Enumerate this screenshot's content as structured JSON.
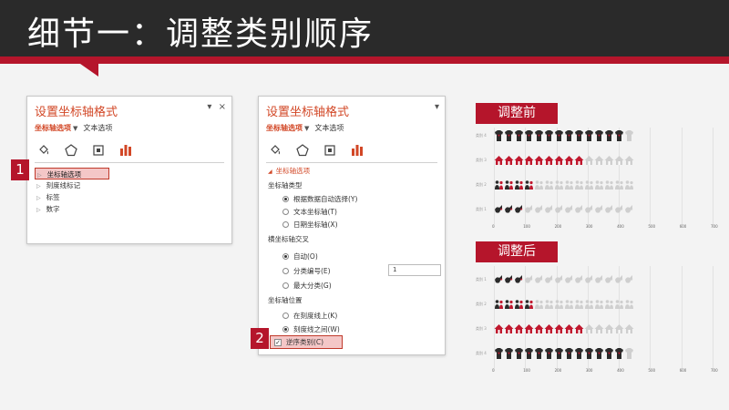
{
  "header": {
    "title": "细节一：调整类别顺序"
  },
  "panel1": {
    "title": "设置坐标轴格式",
    "close_label": "×",
    "pin_label": "▾",
    "tab_axis": "坐标轴选项",
    "tab_text": "文本选项",
    "icons": [
      "fill-bucket-icon",
      "pentagon-effects-icon",
      "size-properties-icon",
      "bar-chart-icon"
    ],
    "tree": [
      "坐标轴选项",
      "刻度线标记",
      "标签",
      "数字"
    ]
  },
  "panel2": {
    "title": "设置坐标轴格式",
    "pin_label": "▾",
    "tab_axis": "坐标轴选项",
    "tab_text": "文本选项",
    "section_axis_options": "坐标轴选项",
    "axis_type_heading": "坐标轴类型",
    "axis_type_options": [
      "根据数据自动选择(Y)",
      "文本坐标轴(T)",
      "日期坐标轴(X)"
    ],
    "axis_type_selected": 0,
    "cross_heading": "横坐标轴交叉",
    "cross_options": [
      "自动(O)",
      "分类编号(E)",
      "最大分类(G)"
    ],
    "cross_selected": 0,
    "category_number_value": "1",
    "position_heading": "坐标轴位置",
    "position_options": [
      "在刻度线上(K)",
      "刻度线之间(W)"
    ],
    "position_selected": 1,
    "reverse_label": "逆序类别(C)",
    "reverse_checked": true
  },
  "steps": {
    "step1": "1",
    "step2": "2"
  },
  "charts": {
    "before_label": "调整前",
    "after_label": "调整后",
    "axis_ticks": [
      "0",
      "100",
      "200",
      "300",
      "400",
      "500",
      "600",
      "700"
    ],
    "before_rows": [
      {
        "label": "类别 4",
        "icon": "tshirt",
        "filled": 13,
        "total": 14
      },
      {
        "label": "类别 3",
        "icon": "house",
        "filled": 9,
        "total": 14
      },
      {
        "label": "类别 2",
        "icon": "people",
        "filled": 4,
        "total": 14
      },
      {
        "label": "类别 1",
        "icon": "bird",
        "filled": 3,
        "total": 14
      }
    ],
    "after_rows": [
      {
        "label": "类别 1",
        "icon": "bird",
        "filled": 3,
        "total": 14
      },
      {
        "label": "类别 2",
        "icon": "people",
        "filled": 4,
        "total": 14
      },
      {
        "label": "类别 3",
        "icon": "house",
        "filled": 9,
        "total": 14
      },
      {
        "label": "类别 4",
        "icon": "tshirt",
        "filled": 13,
        "total": 14
      }
    ],
    "colors": {
      "dark": "#2b2b2b",
      "red": "#c0182e",
      "light": "#cfcfcf"
    }
  }
}
